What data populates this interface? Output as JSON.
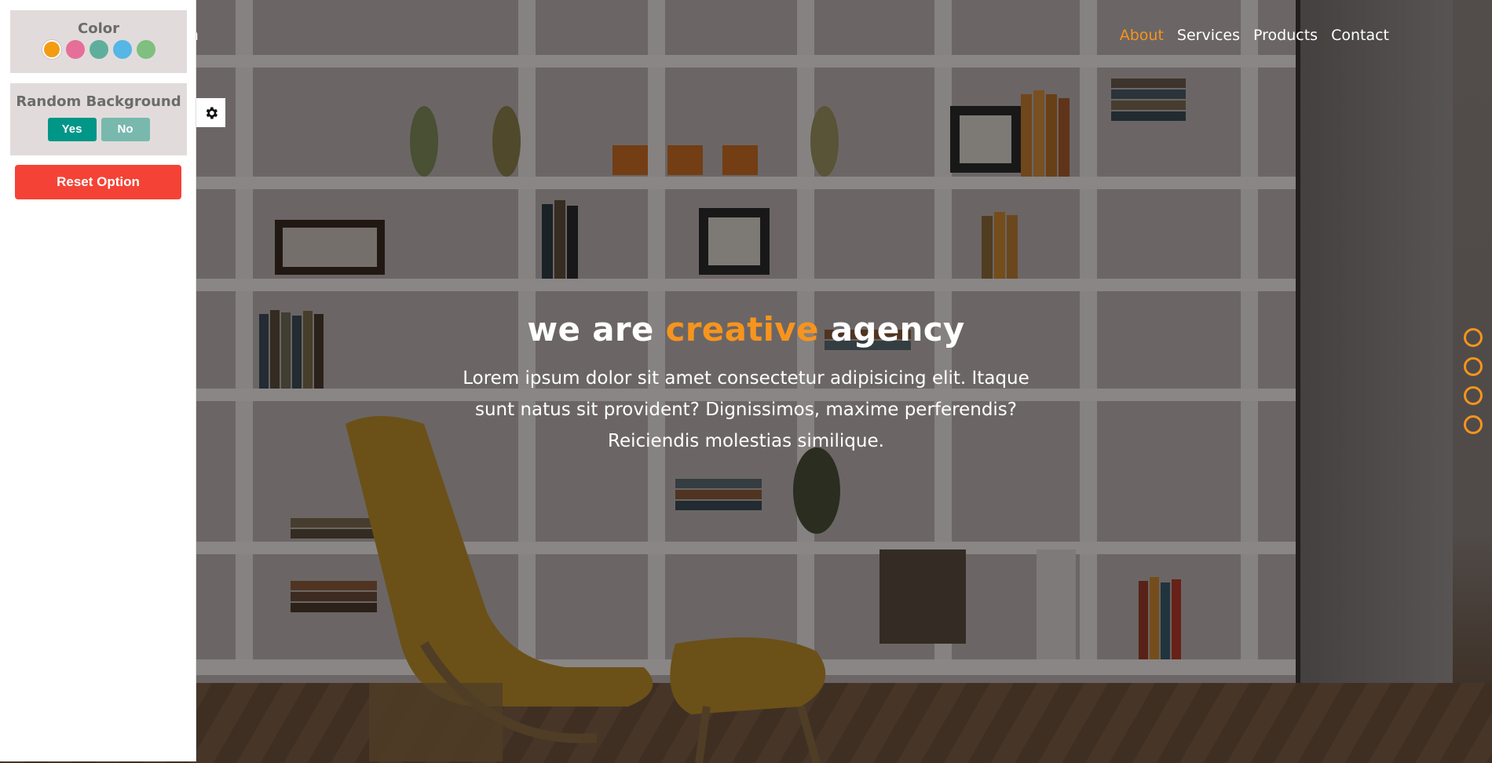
{
  "brand": {
    "text": "gn"
  },
  "nav": {
    "items": [
      {
        "label": "About",
        "active": true
      },
      {
        "label": "Services",
        "active": false
      },
      {
        "label": "Products",
        "active": false
      },
      {
        "label": "Contact",
        "active": false
      }
    ]
  },
  "hero": {
    "title_before": "we are",
    "title_accent": "creative",
    "title_after": "agency",
    "description": "Lorem ipsum dolor sit amet consectetur adipisicing elit. Itaque sunt natus sit provident? Dignissimos, maxime perferendis? Reiciendis molestias similique."
  },
  "settings": {
    "color_title": "Color",
    "swatches": [
      "#f39c12",
      "#e66f99",
      "#5fae9c",
      "#56b6e6",
      "#7fbf7f"
    ],
    "selected_swatch": 0,
    "random_bg_title": "Random Background",
    "yes_label": "Yes",
    "no_label": "No",
    "reset_label": "Reset Option"
  },
  "icons": {
    "settings": "gear-icon"
  },
  "colors": {
    "accent": "#f7941d",
    "reset": "#f44336",
    "yes": "#009688",
    "no": "#78b8ad"
  },
  "page_bullets": 4
}
